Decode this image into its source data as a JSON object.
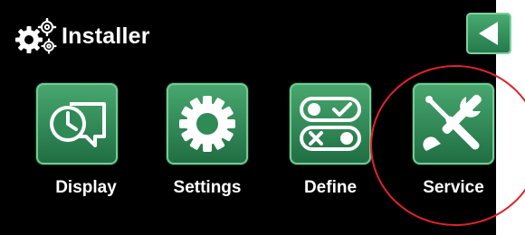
{
  "header": {
    "title": "Installer",
    "icon": "gears-icon",
    "back_icon": "back-arrow-icon"
  },
  "menu": {
    "items": [
      {
        "label": "Display",
        "icon": "clock-display-icon"
      },
      {
        "label": "Settings",
        "icon": "gear-icon"
      },
      {
        "label": "Define",
        "icon": "toggle-switches-icon"
      },
      {
        "label": "Service",
        "icon": "wrench-screwdriver-icon"
      }
    ]
  },
  "colors": {
    "background": "#000000",
    "tile_green": "#2f8a56",
    "tile_border": "#76c996",
    "text": "#ffffff",
    "highlight": "#e2222a"
  }
}
